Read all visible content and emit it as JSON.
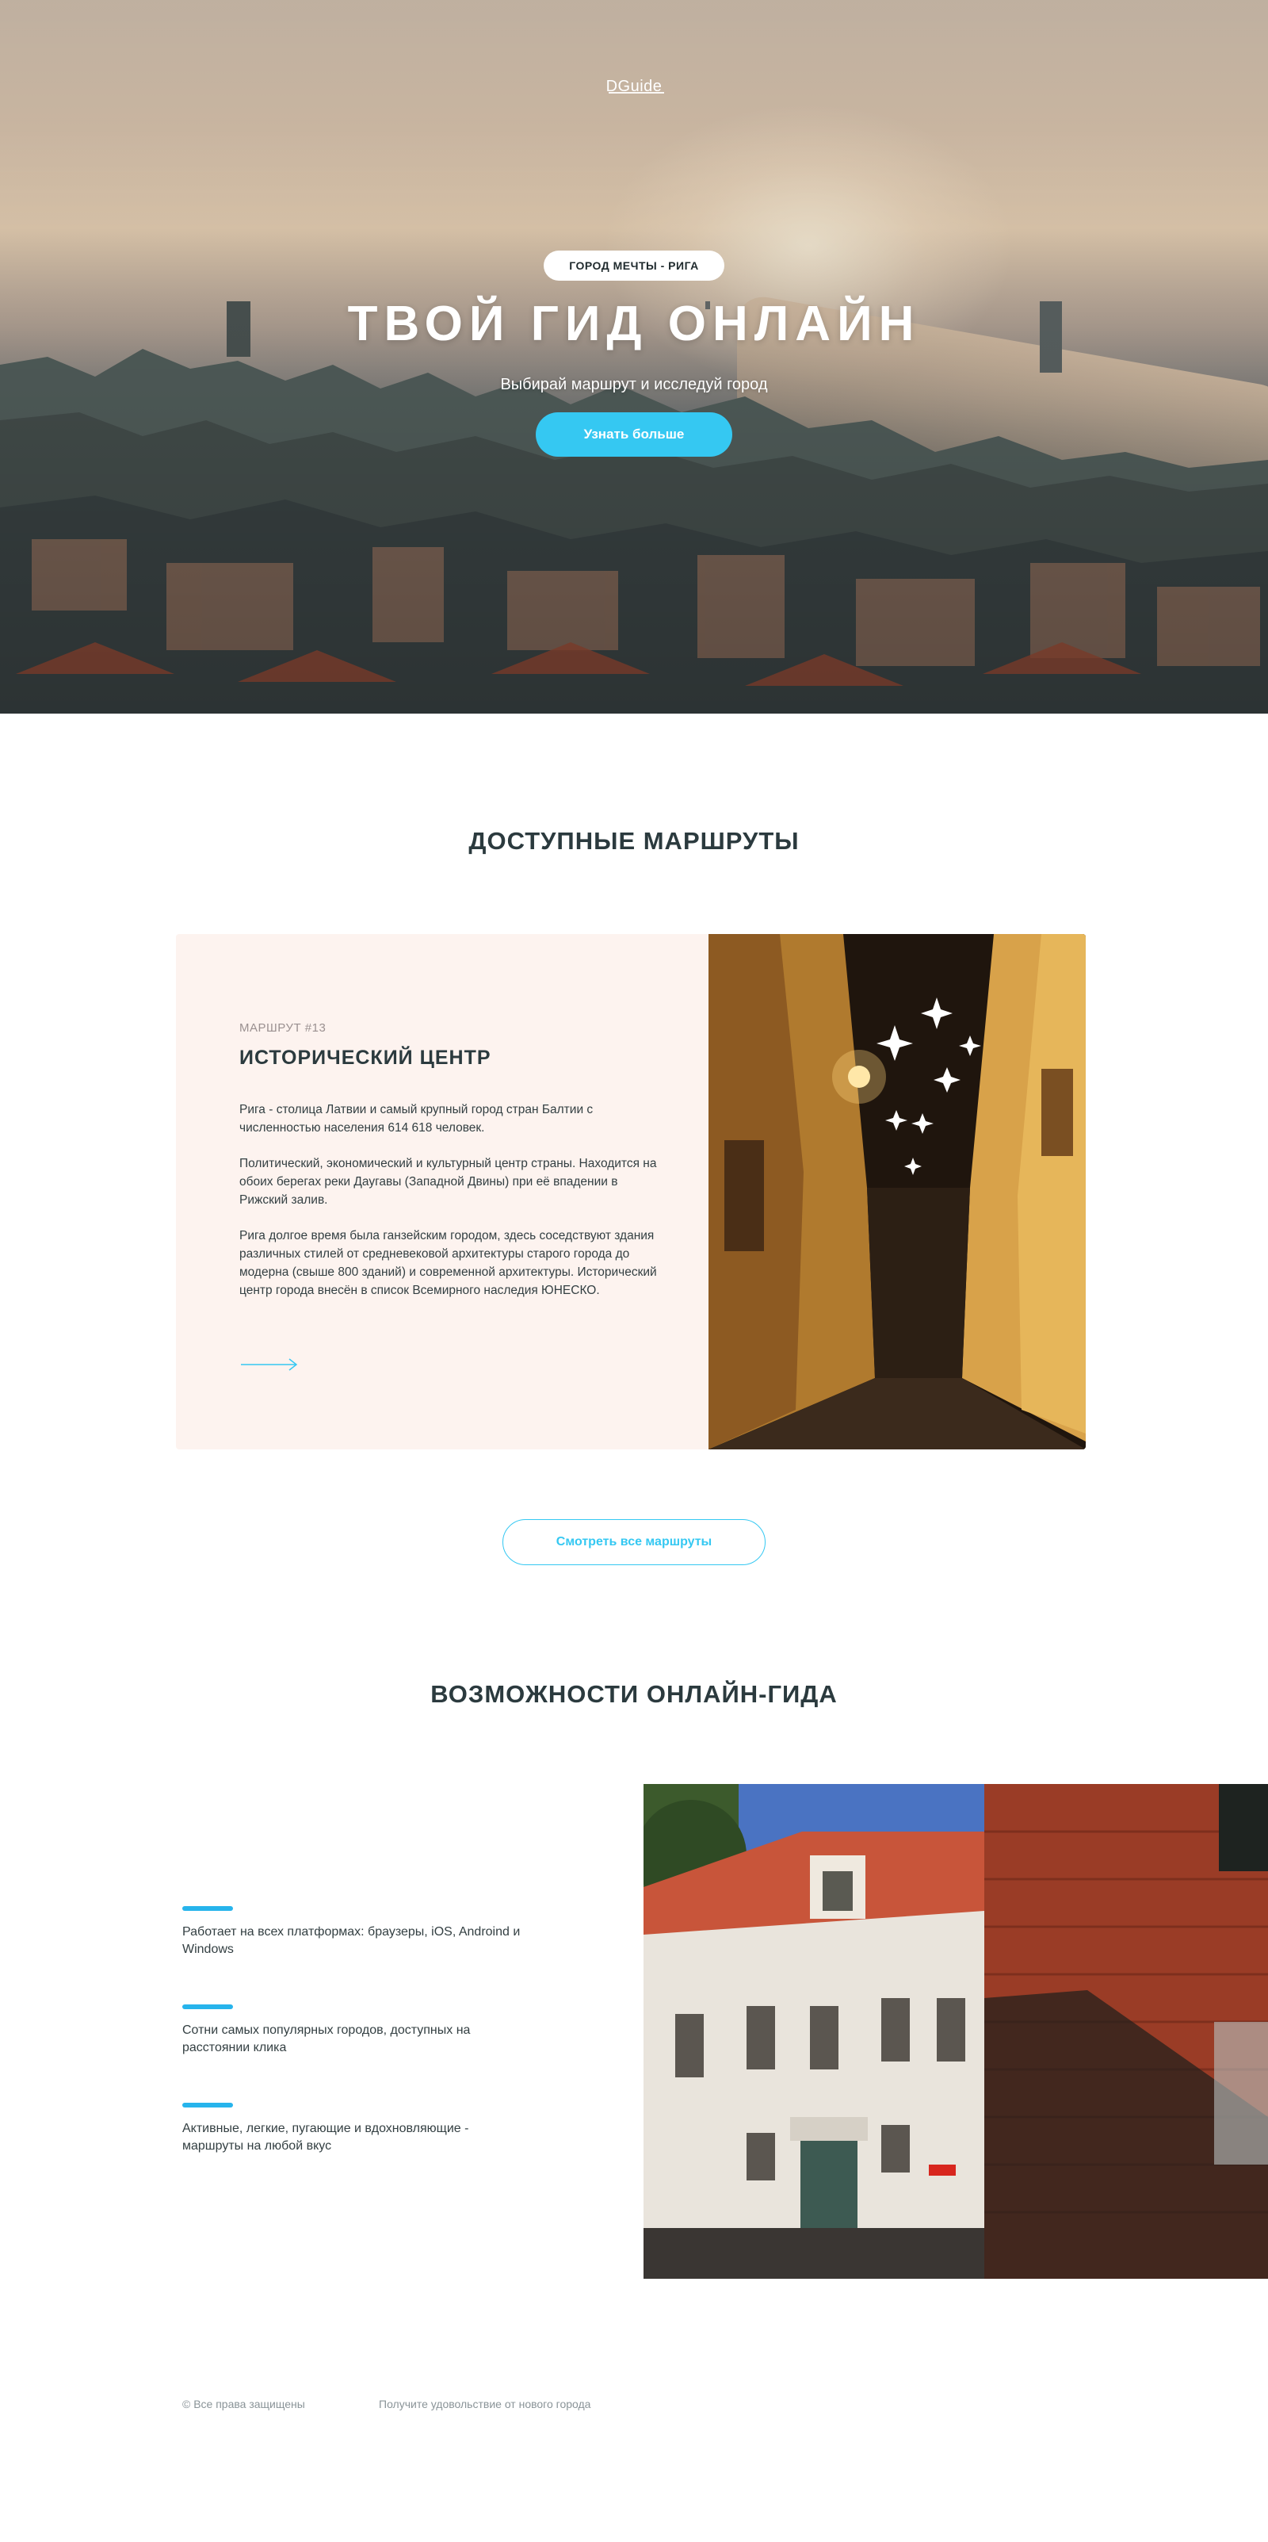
{
  "hero": {
    "logo": "DGuide",
    "badge": "ГОРОД МЕЧТЫ - РИГА",
    "title": "ТВОЙ ГИД ОНЛАЙН",
    "subtitle": "Выбирай маршрут и исследуй город",
    "cta_label": "Узнать больше"
  },
  "routes": {
    "section_title": "ДОСТУПНЫЕ МАРШРУТЫ",
    "card": {
      "kicker": "МАРШРУТ #13",
      "title": "ИСТОРИЧЕСКИЙ ЦЕНТР",
      "paragraphs": [
        "Рига - столица Латвии и самый крупный город стран Балтии с численностью населения 614 618 человек.",
        "Политический, экономический и культурный центр страны. Находится на обоих берегах реки Даугавы (Западной Двины) при её впадении в Рижский залив.",
        "Рига долгое время была ганзейским городом, здесь соседствуют здания различных стилей от средневековой архитектуры старого города до модерна (свыше 800 зданий) и современной архитектуры. Исторический центр города внесён в список Всемирного наследия ЮНЕСКО."
      ]
    },
    "all_routes_label": "Смотреть все маршруты"
  },
  "features": {
    "section_title": "ВОЗМОЖНОСТИ ОНЛАЙН-ГИДА",
    "items": [
      "Работает на всех платформах: браузеры, iOS, Androind и Windows",
      "Сотни самых популярных городов, доступных на расстоянии клика",
      "Активные, легкие, пугающие и вдохновляющие - маршруты на любой вкус"
    ]
  },
  "footer": {
    "copyright": "© Все права защищены",
    "tagline": "Получите удовольствие от нового города"
  },
  "colors": {
    "accent": "#35c8f2",
    "feature_bar": "#27b4ec",
    "card_bg": "#fdf3ef",
    "heading": "#2b3a3e"
  }
}
